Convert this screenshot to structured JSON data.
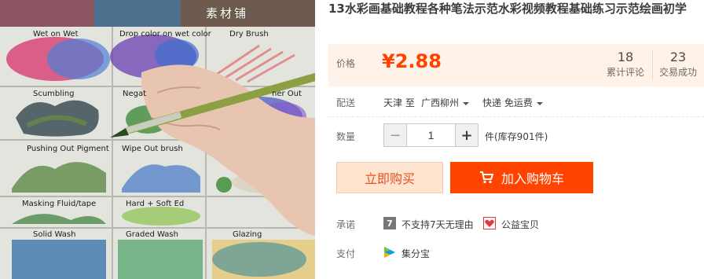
{
  "image": {
    "watermark": "素材铺",
    "swatches": [
      "Wet on Wet",
      "Drop color on wet color",
      "Dry Brush",
      "Scumbling",
      "Negat",
      "ner Out",
      "Pushing Out Pigment",
      "Wipe Out brush",
      "Masking Fluid/tape",
      "Hard + Soft Ed",
      "Solid Wash",
      "Graded Wash",
      "Glazing"
    ]
  },
  "product": {
    "title": "13水彩画基础教程各种笔法示范水彩视频教程基础练习示范绘画初学"
  },
  "price": {
    "label": "价格",
    "value": "¥2.88",
    "reviews_count": "18",
    "reviews_label": "累计评论",
    "sales_count": "23",
    "sales_label": "交易成功"
  },
  "shipping": {
    "label": "配送",
    "from": "天津 至",
    "to": "广西柳州",
    "method": "快递 免运费"
  },
  "quantity": {
    "label": "数量",
    "value": "1",
    "minus": "−",
    "plus": "+",
    "stock": "件(库存901件)"
  },
  "buttons": {
    "buy_now": "立即购买",
    "add_to_cart": "加入购物车"
  },
  "promise": {
    "label": "承诺",
    "icon_text": "7",
    "no_return": "不支持7天无理由",
    "charity": "公益宝贝"
  },
  "payment": {
    "label": "支付",
    "method": "集分宝"
  },
  "colors": {
    "accent": "#ff4400",
    "price": "#ff4400",
    "price_bg": "#fff2e8",
    "buy_bg": "#ffe4d0"
  }
}
